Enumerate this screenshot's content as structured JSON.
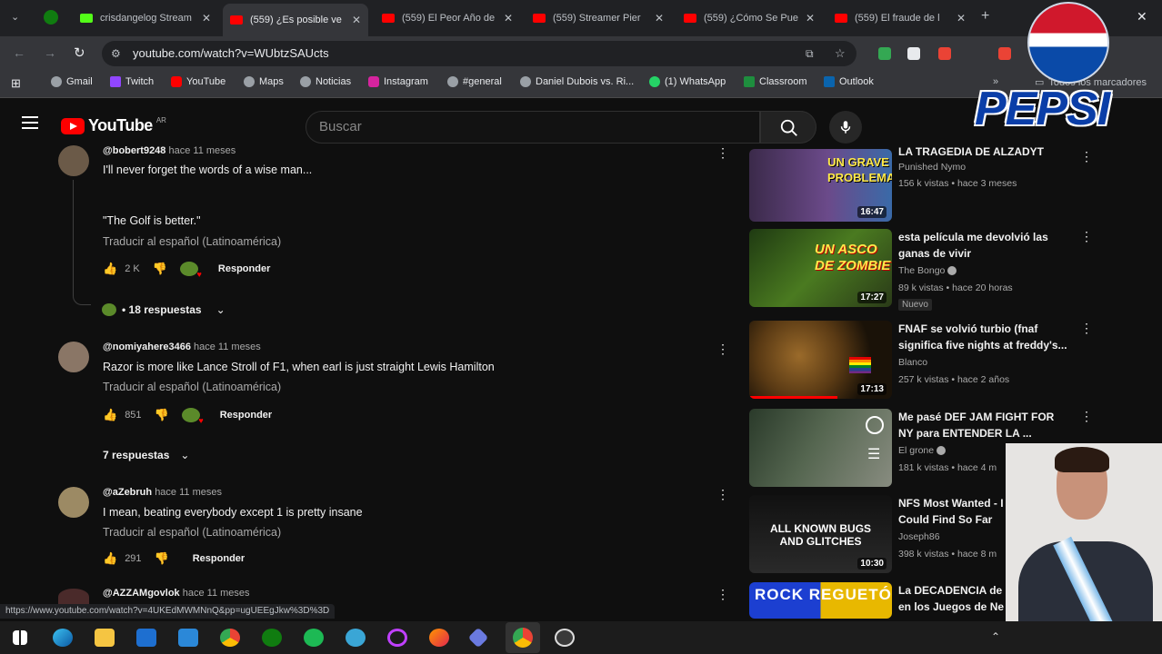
{
  "browser": {
    "tabs": [
      {
        "title": "crisdangelog Stream"
      },
      {
        "title": "(559) ¿Es posible ve"
      },
      {
        "title": "(559) El Peor Año de"
      },
      {
        "title": "(559) Streamer Pier"
      },
      {
        "title": "(559) ¿Cómo Se Pue"
      },
      {
        "title": "(559) El fraude de l"
      }
    ],
    "url": "youtube.com/watch?v=WUbtzSAUcts",
    "bookmarks": [
      "Gmail",
      "Twitch",
      "YouTube",
      "Maps",
      "Noticias",
      "Instagram",
      "#general",
      "Daniel Dubois vs. Ri...",
      "(1) WhatsApp",
      "Classroom",
      "Outlook"
    ],
    "all_bookmarks": "Todos los marcadores",
    "status_url": "https://www.youtube.com/watch?v=4UKEdMWMNnQ&pp=ugUEEgJkw%3D%3D"
  },
  "youtube": {
    "logo": "YouTube",
    "country": "AR",
    "search_placeholder": "Buscar"
  },
  "comments": [
    {
      "author": "@bobert9248",
      "time": "hace 11 meses",
      "lines": [
        "I'll never forget the words of a wise man...",
        "",
        "\"The Golf is better.\""
      ],
      "translate": "Traducir al español (Latinoamérica)",
      "likes": "2 K",
      "reply": "Responder",
      "replies": "• 18 respuestas"
    },
    {
      "author": "@nomiyahere3466",
      "time": "hace 11 meses",
      "lines": [
        "Razor is more like Lance Stroll of F1, when earl is just straight Lewis Hamilton"
      ],
      "translate": "Traducir al español (Latinoamérica)",
      "likes": "851",
      "reply": "Responder",
      "replies": "7 respuestas"
    },
    {
      "author": "@aZebruh",
      "time": "hace 11 meses",
      "lines": [
        "I mean, beating everybody except 1 is pretty insane"
      ],
      "translate": "Traducir al español (Latinoamérica)",
      "likes": "291",
      "reply": "Responder"
    },
    {
      "author": "@AZZAMgovlok",
      "time": "hace 11 meses",
      "lines": [
        ""
      ]
    }
  ],
  "recommendations": [
    {
      "title": "LA TRAGEDIA DE ALZADYT",
      "channel": "Punished Nymo",
      "meta": "156 k vistas • hace 3 meses",
      "duration": "16:47",
      "thumb_text": "UN GRAVE PROBLEMA"
    },
    {
      "title": "esta película me devolvió las ganas de vivir",
      "channel": "The Bongo",
      "meta": "89 k vistas • hace 20 horas",
      "duration": "17:27",
      "badge": "Nuevo",
      "thumb_text": "UN ASCO DE ZOMBIE"
    },
    {
      "title": "FNAF se volvió turbio (fnaf significa five nights at freddy's...",
      "channel": "Blanco",
      "meta": "257 k vistas • hace 2 años",
      "duration": "17:13"
    },
    {
      "title": "Me pasé DEF JAM FIGHT FOR NY para ENTENDER LA ...",
      "channel": "El grone",
      "meta": "181 k vistas • hace 4 m"
    },
    {
      "title": "NFS Most Wanted - I Could Find So Far",
      "channel": "Joseph86",
      "meta": "398 k vistas • hace 8 m",
      "duration": "10:30",
      "thumb_text": "ALL KNOWN BUGS AND GLITCHES"
    },
    {
      "title": "La DECADENCIA de en los Juegos de Ne",
      "thumb_text": "ROCK REGUETÓN"
    }
  ],
  "overlay": {
    "brand": "PEPSI"
  }
}
